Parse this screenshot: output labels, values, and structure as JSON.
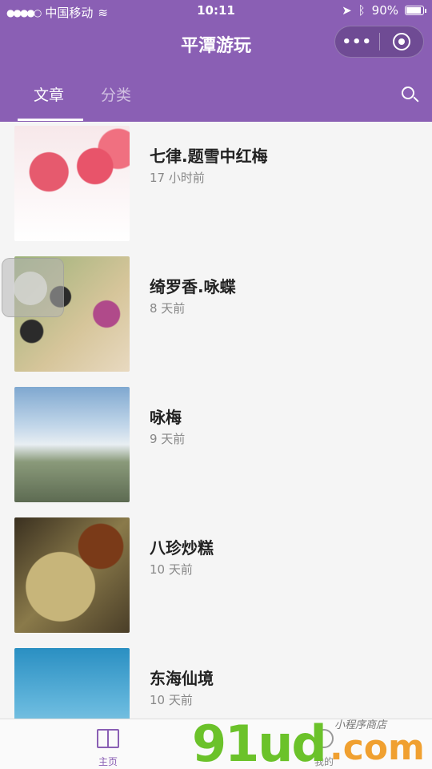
{
  "status_bar": {
    "carrier": "中国移动",
    "time": "10:11",
    "battery": "90%"
  },
  "nav": {
    "title": "平潭游玩",
    "more_icon": "more-dots-icon",
    "close_icon": "target-icon"
  },
  "tabs": [
    {
      "label": "文章",
      "active": true
    },
    {
      "label": "分类",
      "active": false
    }
  ],
  "articles": [
    {
      "title": "七律.题雪中红梅",
      "time": "17 小时前"
    },
    {
      "title": "绮罗香.咏蝶",
      "time": "8 天前"
    },
    {
      "title": "咏梅",
      "time": "9 天前"
    },
    {
      "title": "八珍炒糕",
      "time": "10 天前"
    },
    {
      "title": "东海仙境",
      "time": "10 天前"
    }
  ],
  "bottom_nav": [
    {
      "label": "主页",
      "icon": "book-icon",
      "active": true
    },
    {
      "label": "我的",
      "icon": "user-icon",
      "active": false
    }
  ],
  "watermark": {
    "main": "91ud",
    "suffix": ".com",
    "tagline": "小程序商店"
  },
  "colors": {
    "theme": "#8a5fb4",
    "background": "#f5f5f5"
  }
}
